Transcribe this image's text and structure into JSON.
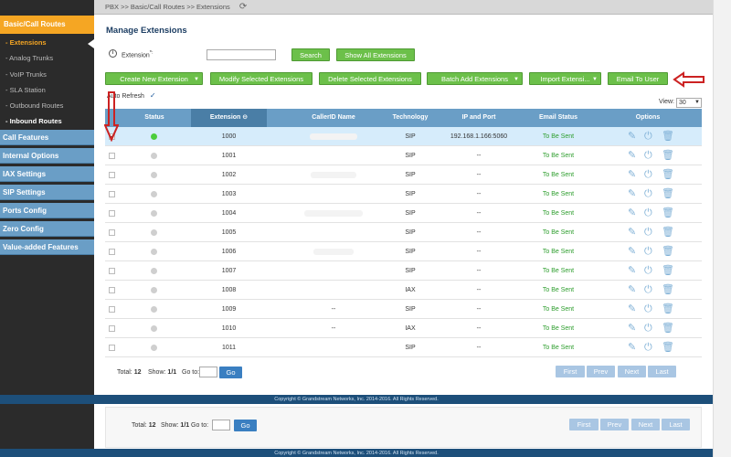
{
  "breadcrumb": "PBX >> Basic/Call Routes >> Extensions",
  "sidebar": {
    "header": "Basic/Call Routes",
    "subitems": [
      {
        "label": "- Extensions",
        "state": "active"
      },
      {
        "label": "- Analog Trunks",
        "state": "normal"
      },
      {
        "label": "- VoIP Trunks",
        "state": "normal"
      },
      {
        "label": "- SLA Station",
        "state": "normal"
      },
      {
        "label": "- Outbound Routes",
        "state": "normal"
      },
      {
        "label": "- Inbound Routes",
        "state": "bold"
      }
    ],
    "sections": [
      "Call Features",
      "Internal Options",
      "IAX Settings",
      "SIP Settings",
      "Ports Config",
      "Zero Config",
      "Value-added Features"
    ]
  },
  "page": {
    "title": "Manage Extensions",
    "extension_label": "Extension",
    "extension_required": "*:",
    "extension_value": "",
    "search_label": "Search",
    "show_all_label": "Show All Extensions",
    "auto_refresh_label": "Auto Refresh",
    "auto_refresh_checked": "✓",
    "view_label": "View:",
    "view_value": "30"
  },
  "actions": {
    "create": "Create New Extension",
    "modify": "Modify Selected Extensions",
    "delete": "Delete Selected Extensions",
    "batch_add": "Batch Add Extensions",
    "import": "Import Extensi...",
    "email": "Email To User"
  },
  "table": {
    "columns": [
      "Status",
      "Extension",
      "CallerID Name",
      "Technology",
      "IP and Port",
      "Email Status",
      "Options"
    ],
    "rows": [
      {
        "selected": true,
        "status": "online",
        "extension": "1000",
        "callerid": "",
        "tech": "SIP",
        "ip": "192.168.1.166:5060",
        "email": "To Be Sent"
      },
      {
        "selected": false,
        "status": "offline",
        "extension": "1001",
        "callerid": "",
        "tech": "SIP",
        "ip": "--",
        "email": "To Be Sent"
      },
      {
        "selected": false,
        "status": "offline",
        "extension": "1002",
        "callerid": "",
        "tech": "SIP",
        "ip": "--",
        "email": "To Be Sent"
      },
      {
        "selected": false,
        "status": "offline",
        "extension": "1003",
        "callerid": "",
        "tech": "SIP",
        "ip": "--",
        "email": "To Be Sent"
      },
      {
        "selected": false,
        "status": "offline",
        "extension": "1004",
        "callerid": "",
        "tech": "SIP",
        "ip": "--",
        "email": "To Be Sent"
      },
      {
        "selected": false,
        "status": "offline",
        "extension": "1005",
        "callerid": "",
        "tech": "SIP",
        "ip": "--",
        "email": "To Be Sent"
      },
      {
        "selected": false,
        "status": "offline",
        "extension": "1006",
        "callerid": "",
        "tech": "SIP",
        "ip": "--",
        "email": "To Be Sent"
      },
      {
        "selected": false,
        "status": "offline",
        "extension": "1007",
        "callerid": "",
        "tech": "SIP",
        "ip": "--",
        "email": "To Be Sent"
      },
      {
        "selected": false,
        "status": "offline",
        "extension": "1008",
        "callerid": "",
        "tech": "IAX",
        "ip": "--",
        "email": "To Be Sent"
      },
      {
        "selected": false,
        "status": "offline",
        "extension": "1009",
        "callerid": "--",
        "tech": "SIP",
        "ip": "--",
        "email": "To Be Sent"
      },
      {
        "selected": false,
        "status": "offline",
        "extension": "1010",
        "callerid": "--",
        "tech": "IAX",
        "ip": "--",
        "email": "To Be Sent"
      },
      {
        "selected": false,
        "status": "offline",
        "extension": "1011",
        "callerid": "",
        "tech": "SIP",
        "ip": "--",
        "email": "To Be Sent"
      }
    ]
  },
  "pager": {
    "total_label": "Total:",
    "total": "12",
    "show_label": "Show:",
    "show": "1/1",
    "goto_label": "Go to:",
    "go": "Go",
    "first": "First",
    "prev": "Prev",
    "next": "Next",
    "last": "Last"
  },
  "footer": "Copyright © Grandstream Networks, Inc. 2014-2016. All Rights Reserved.",
  "icons": {
    "refresh": "refresh-icon",
    "edit": "pencil-icon",
    "reboot": "power-icon",
    "delete": "trash-icon"
  },
  "colors": {
    "sidebar_active": "#f5a623",
    "section": "#6a9ec6",
    "button_green": "#6cc04a",
    "online": "#4ccd3c",
    "annotation_red": "#cc2222"
  }
}
